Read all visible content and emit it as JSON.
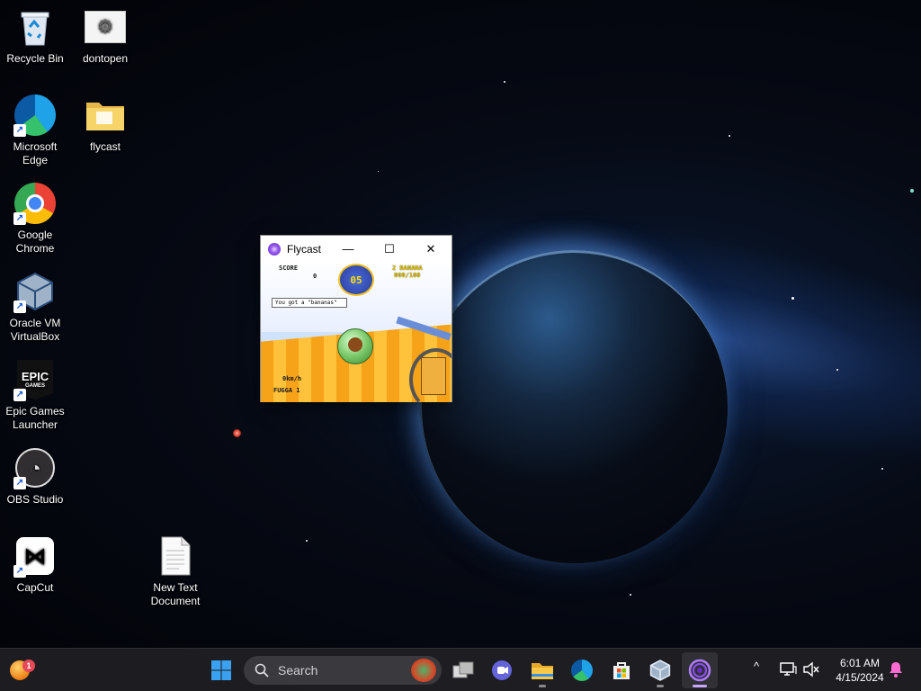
{
  "desktop": {
    "icons": [
      {
        "label": "Recycle Bin",
        "icon": "recycle-bin-icon"
      },
      {
        "label": "dontopen",
        "icon": "settings-file-icon"
      },
      {
        "label": "Microsoft Edge",
        "icon": "edge-icon"
      },
      {
        "label": "flycast",
        "icon": "folder-icon"
      },
      {
        "label": "Google Chrome",
        "icon": "chrome-icon"
      },
      {
        "label": "Oracle VM VirtualBox",
        "icon": "virtualbox-icon"
      },
      {
        "label": "Epic Games Launcher",
        "icon": "epic-games-icon"
      },
      {
        "label": "OBS Studio",
        "icon": "obs-icon"
      },
      {
        "label": "CapCut",
        "icon": "capcut-icon"
      },
      {
        "label": "New Text Document",
        "icon": "text-document-icon"
      }
    ]
  },
  "window": {
    "title": "Flycast",
    "minimize": "—",
    "maximize": "☐",
    "close": "✕",
    "game": {
      "score_label": "SCORE",
      "score_value": "0",
      "timer": "05",
      "banana_label": "2 BANANA",
      "banana_count": "000/100",
      "message": "You got a \"bananas\"",
      "speed": "0km/h",
      "player": "FUGGA 1"
    }
  },
  "taskbar": {
    "search_label": "Search",
    "notification_count": "1",
    "clock_time": "6:01 AM",
    "clock_date": "4/15/2024",
    "accent": "#c9a6ff"
  }
}
